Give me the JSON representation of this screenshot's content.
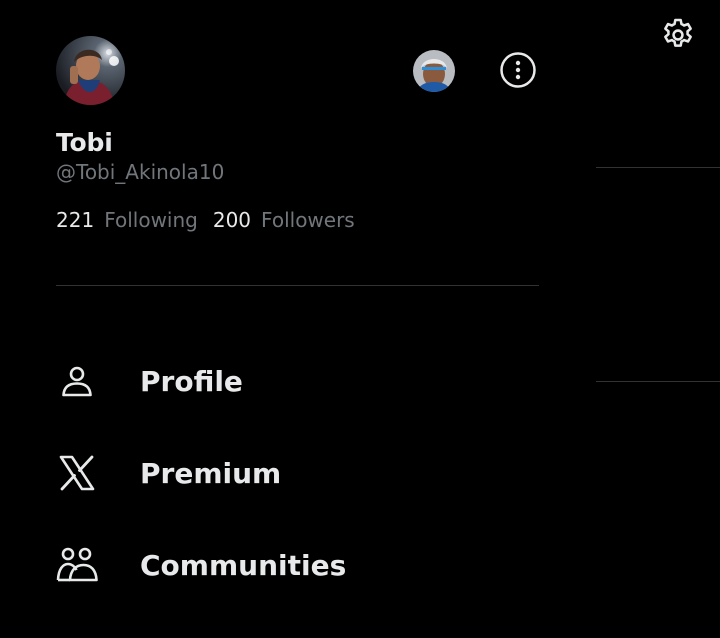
{
  "colors": {
    "background": "#000000",
    "text_primary": "#e7e9ea",
    "text_secondary": "#71767b",
    "divider": "#2f3336"
  },
  "profile": {
    "display_name": "Tobi",
    "handle": "@Tobi_Akinola10",
    "following_count": "221",
    "following_label": "Following",
    "followers_count": "200",
    "followers_label": "Followers"
  },
  "header": {
    "settings_icon": "gear-icon",
    "more_icon": "more-vertical-icon"
  },
  "nav": {
    "items": [
      {
        "label": "Profile",
        "icon": "person-icon"
      },
      {
        "label": "Premium",
        "icon": "x-logo-icon"
      },
      {
        "label": "Communities",
        "icon": "communities-icon"
      }
    ]
  }
}
